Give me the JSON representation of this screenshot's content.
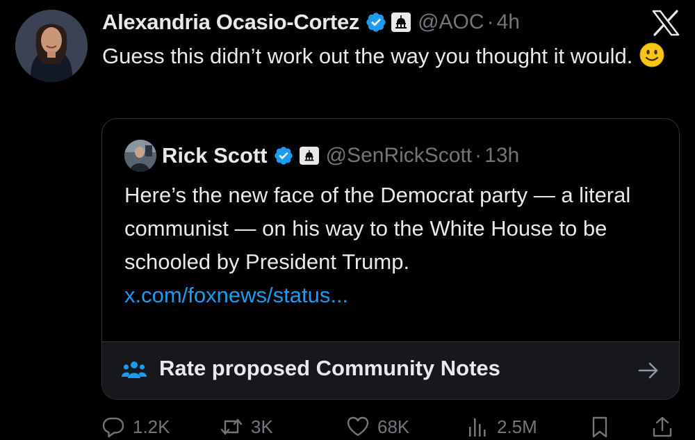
{
  "tweet": {
    "author_name": "Alexandria Ocasio-Cortez",
    "handle": "@AOC",
    "separator": "·",
    "time": "4h",
    "text": "Guess this didn’t work out the way you thought it would.",
    "emoji": "slightly-smiling-face"
  },
  "quote": {
    "author_name": "Rick Scott",
    "handle": "@SenRickScott",
    "separator": "·",
    "time": "13h",
    "text": "Here’s the new face of the Democrat party — a literal communist — on his way to the White House to be schooled by President Trump.",
    "link": "x.com/foxnews/status..."
  },
  "community_notes": {
    "label": "Rate proposed Community Notes"
  },
  "actions": {
    "replies": "1.2K",
    "reposts": "3K",
    "likes": "68K",
    "views": "2.5M"
  },
  "colors": {
    "background": "#000000",
    "text": "#e7e9ea",
    "muted": "#71767b",
    "link": "#1d9bf0",
    "verified_badge": "#1d9bf0",
    "notes_icon": "#1d9bf0",
    "border": "#2f3336"
  },
  "icons": {
    "verified": "verified-badge-icon",
    "government": "capitol-icon",
    "app": "x-logo-icon",
    "notes": "community-notes-icon",
    "arrow": "arrow-right-icon",
    "reply": "reply-icon",
    "repost": "repost-icon",
    "like": "heart-icon",
    "views": "views-icon",
    "bookmark": "bookmark-icon",
    "share": "share-icon"
  }
}
